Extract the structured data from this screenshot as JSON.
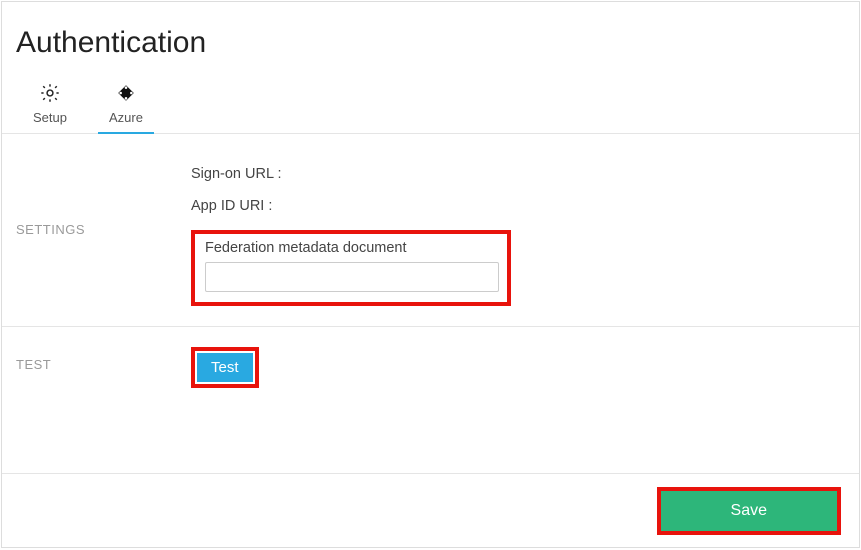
{
  "title": "Authentication",
  "tabs": [
    {
      "label": "Setup",
      "active": false
    },
    {
      "label": "Azure",
      "active": true
    }
  ],
  "settings": {
    "heading": "SETTINGS",
    "signon_label": "Sign-on URL :",
    "appid_label": "App ID URI :",
    "fmd_label": "Federation metadata document",
    "fmd_value": ""
  },
  "test": {
    "heading": "TEST",
    "button_label": "Test"
  },
  "footer": {
    "save_label": "Save"
  }
}
